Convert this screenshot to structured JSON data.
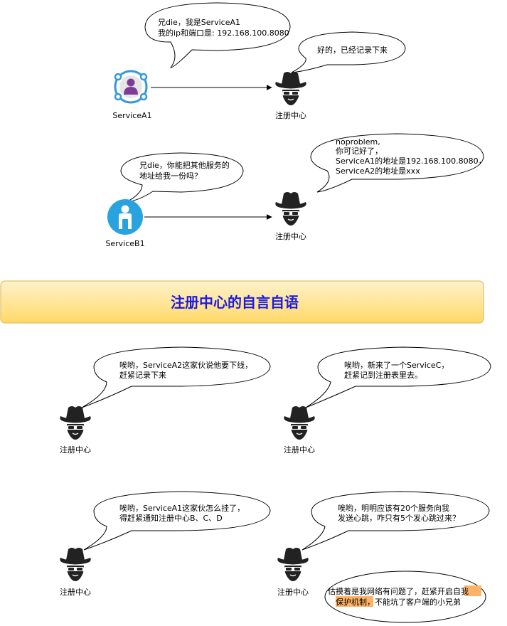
{
  "actors": {
    "service_a1": "ServiceA1",
    "service_b1": "ServiceB1",
    "registry": "注册中心"
  },
  "bubbles": {
    "a1_register": [
      "兄die，我是ServiceA1",
      "我的ip和端口是: 192.168.100.8080"
    ],
    "a1_reply": [
      "好的，已经记录下来"
    ],
    "b1_request": [
      "兄die，你能把其他服务的",
      "地址给我一份吗？"
    ],
    "b1_reply": [
      "noproblem,",
      "你可记好了，",
      "ServiceA1的地址是192.168.100.8080，",
      "ServiceA2的地址是xxx"
    ],
    "offline": [
      "唉哟，ServiceA2这家伙说他要下线，",
      "赶紧记录下来"
    ],
    "new_service": [
      "唉哟，新来了一个ServiceC，",
      "赶紧记到注册表里去。"
    ],
    "down": [
      "唉哟，ServiceA1这家伙怎么挂了，",
      "得赶紧通知注册中心B、C、D"
    ],
    "heartbeat": [
      "唉哟，明明应该有20个服务向我",
      "发送心跳，咋只有5个发心跳过来？"
    ],
    "protect": {
      "pre": "估摸着是我网络有问题了，赶紧开启",
      "highlight1": "自我",
      "highlight2": "保护机制",
      "post": "，不能坑了客户端的小兄弟"
    }
  },
  "banner": {
    "title": "注册中心的自言自语"
  },
  "colors": {
    "banner_top": "#fff2cc",
    "banner_bottom": "#ffd966",
    "banner_border": "#d6b656",
    "banner_text": "#1a1ae6",
    "service_a1_ring": "#3399dd",
    "service_a1_person": "#7d3c98",
    "service_b1": "#29a3e0",
    "highlight": "#ffb366"
  }
}
